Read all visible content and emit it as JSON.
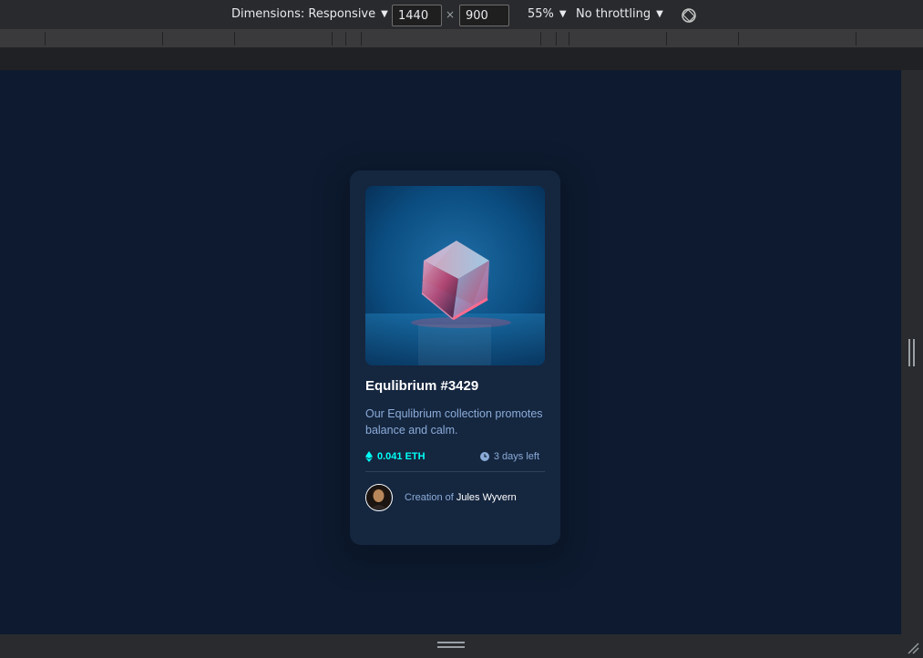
{
  "toolbar": {
    "dimensions_label": "Dimensions: Responsive",
    "width": "1440",
    "height": "900",
    "zoom": "55%",
    "throttling": "No throttling"
  },
  "card": {
    "title": "Equlibrium #3429",
    "description": "Our Equlibrium collection promotes balance and calm.",
    "price": "0.041 ETH",
    "time_left": "3 days left",
    "creation_prefix": "Creation of",
    "creator_name": "Jules Wyvern"
  },
  "colors": {
    "viewport_bg": "#0d1a2f",
    "card_bg": "#15263f",
    "accent_cyan": "#00fff7",
    "soft_blue": "#8bacd9",
    "white": "#ffffff"
  },
  "icons": [
    "caret-down-icon",
    "rotate-icon",
    "ethereum-icon",
    "clock-icon",
    "resize-corner-icon"
  ]
}
